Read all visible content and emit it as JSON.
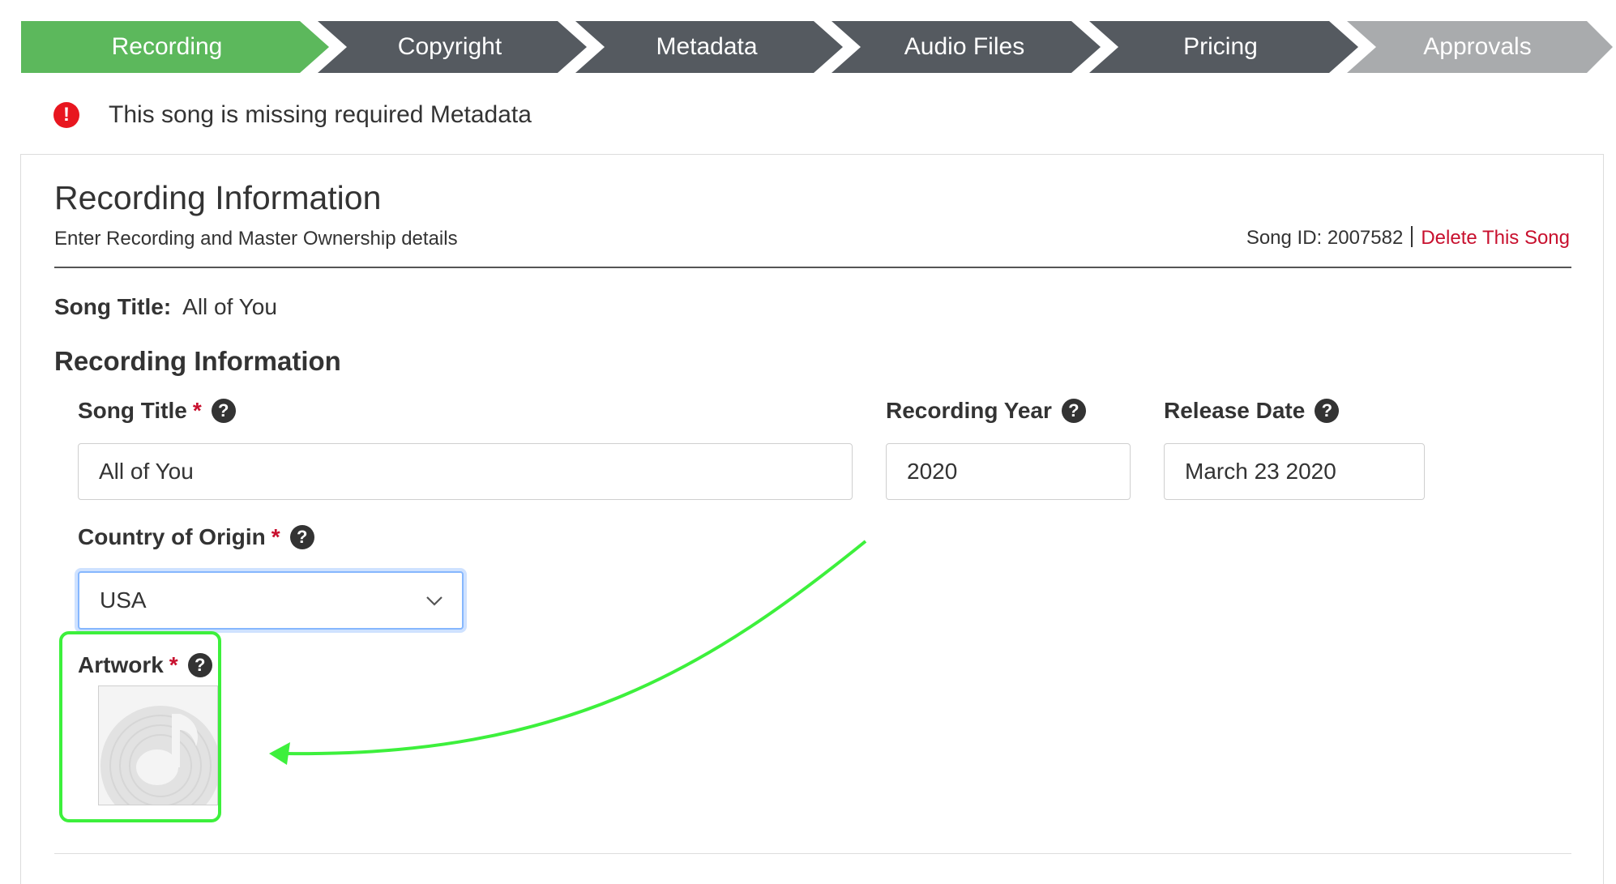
{
  "stepper": {
    "steps": [
      {
        "label": "Recording",
        "state": "active",
        "color": "#5cb85c"
      },
      {
        "label": "Copyright",
        "state": "complete",
        "color": "#555a60"
      },
      {
        "label": "Metadata",
        "state": "complete",
        "color": "#555a60"
      },
      {
        "label": "Audio Files",
        "state": "complete",
        "color": "#555a60"
      },
      {
        "label": "Pricing",
        "state": "complete",
        "color": "#555a60"
      },
      {
        "label": "Approvals",
        "state": "pending",
        "color": "#a9abad"
      }
    ]
  },
  "alert": {
    "icon": "exclamation-circle-icon",
    "text": "This song is missing required Metadata",
    "color": "#e8161f"
  },
  "panel": {
    "title": "Recording Information",
    "subtitle": "Enter Recording and Master Ownership details",
    "song_id": "Song ID: 2007582",
    "delete_label": "Delete This Song",
    "summary_label": "Song Title:",
    "summary_value": "All of You",
    "section_title": "Recording Information"
  },
  "form": {
    "song_title": {
      "label": "Song Title",
      "required": "*",
      "value": "All of You"
    },
    "recording_year": {
      "label": "Recording Year",
      "value": "2020"
    },
    "release_date": {
      "label": "Release Date",
      "value": "March 23 2020"
    },
    "country": {
      "label": "Country of Origin",
      "required": "*",
      "value": "USA"
    },
    "artwork": {
      "label": "Artwork",
      "required": "*",
      "placeholder_icon": "music-disc-icon"
    }
  },
  "annotation": {
    "highlight_color": "#3df03c"
  }
}
